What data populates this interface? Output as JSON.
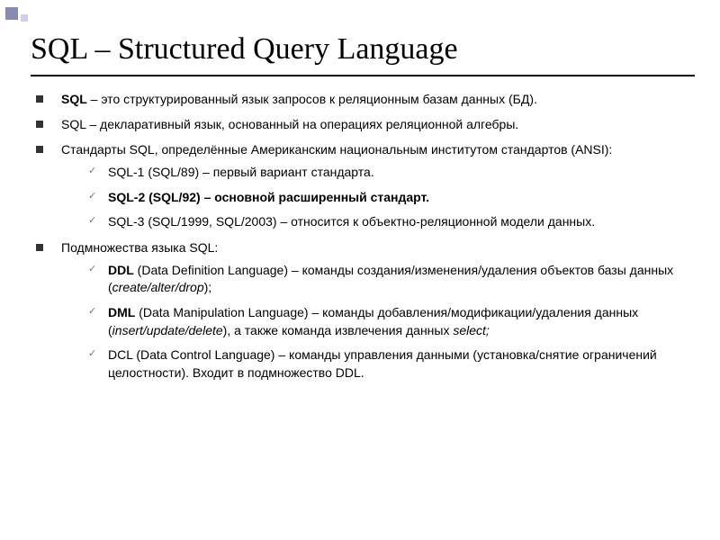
{
  "title": "SQL – Structured Query Language",
  "bullets": [
    {
      "html": "<b>SQL</b> – это структурированный язык запросов к реляционным базам данных (БД)."
    },
    {
      "html": "SQL – декларативный язык, основанный на операциях реляционной алгебры."
    },
    {
      "html": "Стандарты SQL, определённые Американским национальным институтом стандартов (ANSI):",
      "children": [
        {
          "html": "SQL-1 (SQL/89) – первый вариант стандарта."
        },
        {
          "html": "<b>SQL-2 (SQL/92) – основной расширенный стандарт.</b>"
        },
        {
          "html": "SQL-3 (SQL/1999, SQL/2003) – относится к объектно-реляционной модели данных."
        }
      ]
    },
    {
      "html": "Подмножества языка SQL:",
      "children": [
        {
          "html": "<b>DDL</b> (Data Definition Language) – команды создания/изменения/удаления объектов базы данных (<i>create/alter/drop</i>);"
        },
        {
          "html": "<b>DML</b> (Data Manipulation Language) – команды добавления/модификации/удаления данных (<i>insert/update/delete</i>), а также команда извлечения данных <i>select;</i>"
        },
        {
          "html": "DCL (Data Control Language) – команды управления данными (установка/снятие ограничений целостности). Входит в подмножество DDL."
        }
      ]
    }
  ]
}
